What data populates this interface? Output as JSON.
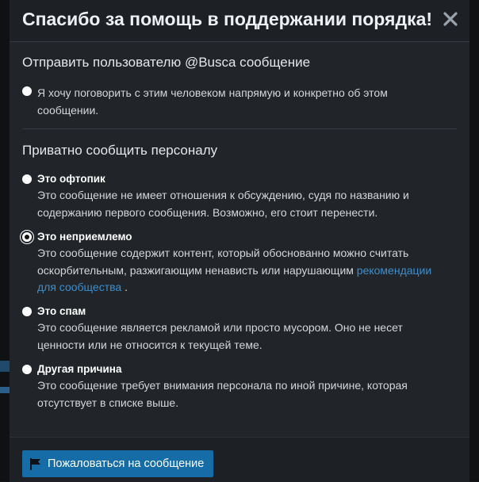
{
  "modal": {
    "title": "Спасибо за помощь в поддержании порядка!"
  },
  "direct_message": {
    "heading": "Отправить пользователю @Busca сообщение",
    "option_text": "Я хочу поговорить с этим человеком напрямую и конкретно об этом сообщении."
  },
  "staff_report": {
    "heading": "Приватно сообщить персоналу",
    "options": [
      {
        "label": "Это офтопик",
        "description": "Это сообщение не имеет отношения к обсуждению, судя по названию и содержанию первого сообщения. Возможно, его стоит перенести.",
        "checked": false
      },
      {
        "label": "Это неприемлемо",
        "description": "Это сообщение содержит контент, который обоснованно можно считать оскорбительным, разжигающим ненависть или нарушающим",
        "link_text": "рекомендации для сообщества",
        "description_suffix": ".",
        "checked": true
      },
      {
        "label": "Это спам",
        "description": "Это сообщение является рекламой или просто мусором. Оно не несет ценности или не относится к текущей теме.",
        "checked": false
      },
      {
        "label": "Другая причина",
        "description": "Это сообщение требует внимания персонала по иной причине, которая отсутствует в списке выше.",
        "checked": false
      }
    ]
  },
  "footer": {
    "submit_label": "Пожаловаться на сообщение",
    "submit_icon": "flag-icon"
  },
  "colors": {
    "modal_bg": "#212529",
    "header_bg": "#1d2125",
    "accent": "#166ca6",
    "link": "#3b8ed0"
  }
}
